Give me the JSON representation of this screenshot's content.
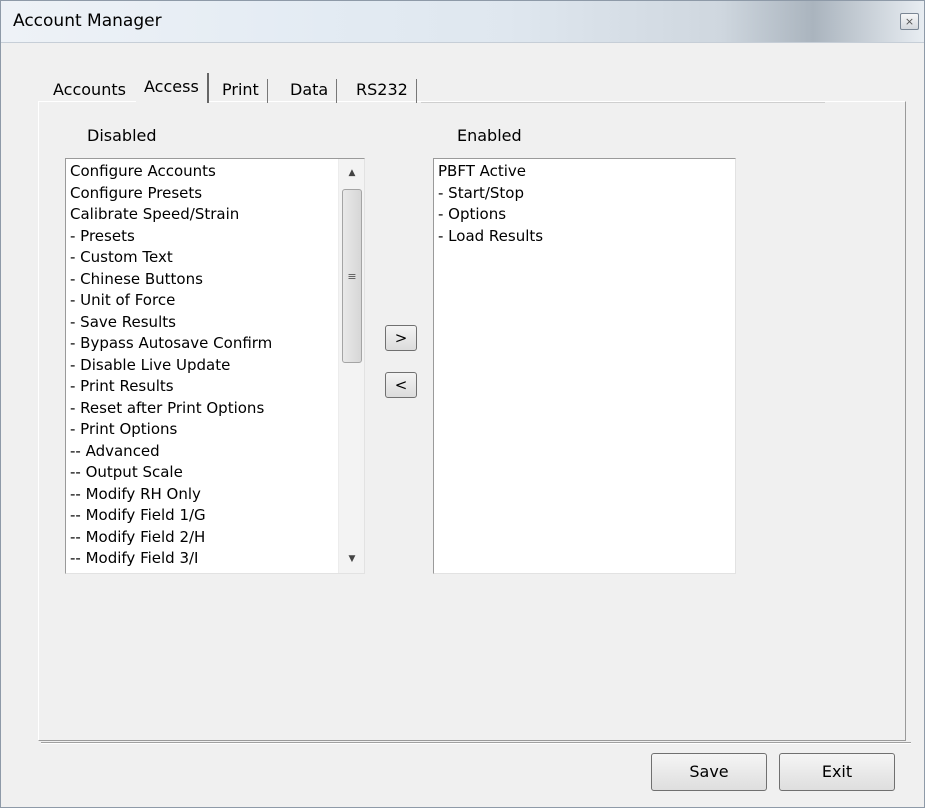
{
  "window": {
    "title": "Account Manager",
    "close_glyph": "×"
  },
  "tabs": [
    {
      "label": "Accounts"
    },
    {
      "label": "Access",
      "active": true
    },
    {
      "label": "Print"
    },
    {
      "label": "Data"
    },
    {
      "label": "RS232"
    }
  ],
  "disabled": {
    "label": "Disabled",
    "items": [
      "Configure Accounts",
      "Configure Presets",
      "Calibrate Speed/Strain",
      "- Presets",
      "- Custom Text",
      "- Chinese Buttons",
      "- Unit of Force",
      "- Save Results",
      "- Bypass Autosave Confirm",
      "- Disable Live Update",
      "- Print Results",
      "- Reset after Print Options",
      "- Print Options",
      "-- Advanced",
      "-- Output Scale",
      "-- Modify RH Only",
      "-- Modify Field 1/G",
      "-- Modify Field 2/H",
      "-- Modify Field 3/I"
    ]
  },
  "enabled": {
    "label": "Enabled",
    "items": [
      "PBFT Active",
      "- Start/Stop",
      "- Options",
      "- Load Results"
    ]
  },
  "scrollbar": {
    "up_glyph": "▲",
    "down_glyph": "▼",
    "grip_glyph": "≡"
  },
  "move": {
    "add_label": ">",
    "remove_label": "<"
  },
  "footer": {
    "save_label": "Save",
    "exit_label": "Exit"
  }
}
